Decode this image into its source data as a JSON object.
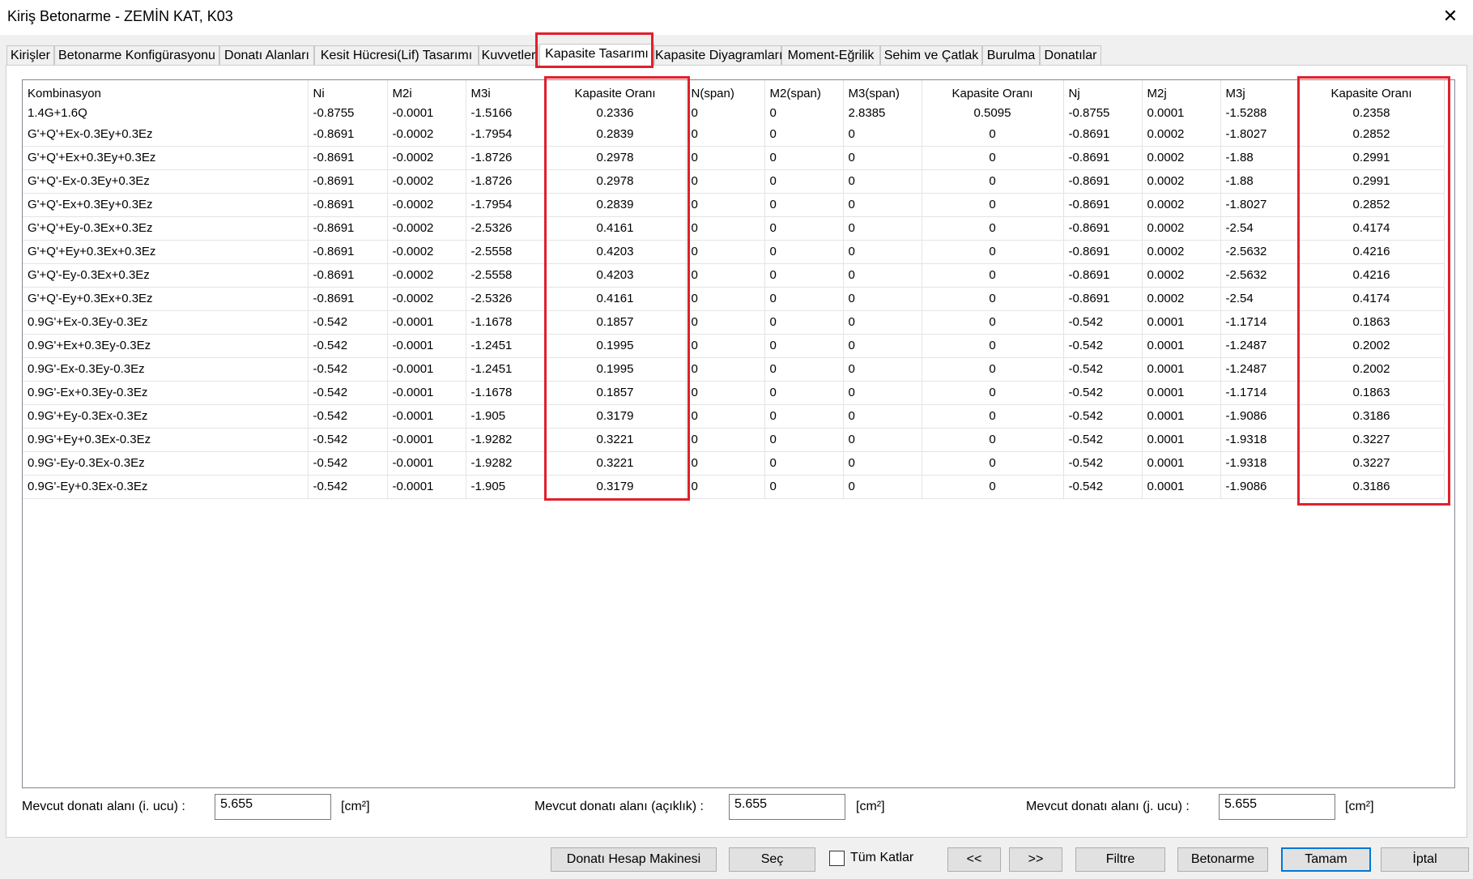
{
  "window": {
    "title": "Kiriş Betonarme - ZEMİN KAT, K03",
    "close_glyph": "✕"
  },
  "tabs": [
    "Kirişler",
    "Betonarme Konfigürasyonu",
    "Donatı Alanları",
    "Kesit Hücresi(Lif) Tasarımı",
    "Kuvvetler",
    "Kapasite Tasarımı",
    "Kapasite Diyagramları",
    "Moment-Eğrilik",
    "Sehim ve Çatlak",
    "Burulma",
    "Donatılar"
  ],
  "active_tab": "Kapasite Tasarımı",
  "table": {
    "columns": [
      "Kombinasyon",
      "Ni",
      "M2i",
      "M3i",
      "Kapasite Oranı",
      "N(span)",
      "M2(span)",
      "M3(span)",
      "Kapasite Oranı",
      "Nj",
      "M2j",
      "M3j",
      "Kapasite Oranı"
    ],
    "rows": [
      [
        "1.4G+1.6Q",
        "-0.8755",
        "-0.0001",
        "-1.5166",
        "0.2336",
        "0",
        "0",
        "2.8385",
        "0.5095",
        "-0.8755",
        "0.0001",
        "-1.5288",
        "0.2358"
      ],
      [
        "G'+Q'+Ex-0.3Ey+0.3Ez",
        "-0.8691",
        "-0.0002",
        "-1.7954",
        "0.2839",
        "0",
        "0",
        "0",
        "0",
        "-0.8691",
        "0.0002",
        "-1.8027",
        "0.2852"
      ],
      [
        "G'+Q'+Ex+0.3Ey+0.3Ez",
        "-0.8691",
        "-0.0002",
        "-1.8726",
        "0.2978",
        "0",
        "0",
        "0",
        "0",
        "-0.8691",
        "0.0002",
        "-1.88",
        "0.2991"
      ],
      [
        "G'+Q'-Ex-0.3Ey+0.3Ez",
        "-0.8691",
        "-0.0002",
        "-1.8726",
        "0.2978",
        "0",
        "0",
        "0",
        "0",
        "-0.8691",
        "0.0002",
        "-1.88",
        "0.2991"
      ],
      [
        "G'+Q'-Ex+0.3Ey+0.3Ez",
        "-0.8691",
        "-0.0002",
        "-1.7954",
        "0.2839",
        "0",
        "0",
        "0",
        "0",
        "-0.8691",
        "0.0002",
        "-1.8027",
        "0.2852"
      ],
      [
        "G'+Q'+Ey-0.3Ex+0.3Ez",
        "-0.8691",
        "-0.0002",
        "-2.5326",
        "0.4161",
        "0",
        "0",
        "0",
        "0",
        "-0.8691",
        "0.0002",
        "-2.54",
        "0.4174"
      ],
      [
        "G'+Q'+Ey+0.3Ex+0.3Ez",
        "-0.8691",
        "-0.0002",
        "-2.5558",
        "0.4203",
        "0",
        "0",
        "0",
        "0",
        "-0.8691",
        "0.0002",
        "-2.5632",
        "0.4216"
      ],
      [
        "G'+Q'-Ey-0.3Ex+0.3Ez",
        "-0.8691",
        "-0.0002",
        "-2.5558",
        "0.4203",
        "0",
        "0",
        "0",
        "0",
        "-0.8691",
        "0.0002",
        "-2.5632",
        "0.4216"
      ],
      [
        "G'+Q'-Ey+0.3Ex+0.3Ez",
        "-0.8691",
        "-0.0002",
        "-2.5326",
        "0.4161",
        "0",
        "0",
        "0",
        "0",
        "-0.8691",
        "0.0002",
        "-2.54",
        "0.4174"
      ],
      [
        "0.9G'+Ex-0.3Ey-0.3Ez",
        "-0.542",
        "-0.0001",
        "-1.1678",
        "0.1857",
        "0",
        "0",
        "0",
        "0",
        "-0.542",
        "0.0001",
        "-1.1714",
        "0.1863"
      ],
      [
        "0.9G'+Ex+0.3Ey-0.3Ez",
        "-0.542",
        "-0.0001",
        "-1.2451",
        "0.1995",
        "0",
        "0",
        "0",
        "0",
        "-0.542",
        "0.0001",
        "-1.2487",
        "0.2002"
      ],
      [
        "0.9G'-Ex-0.3Ey-0.3Ez",
        "-0.542",
        "-0.0001",
        "-1.2451",
        "0.1995",
        "0",
        "0",
        "0",
        "0",
        "-0.542",
        "0.0001",
        "-1.2487",
        "0.2002"
      ],
      [
        "0.9G'-Ex+0.3Ey-0.3Ez",
        "-0.542",
        "-0.0001",
        "-1.1678",
        "0.1857",
        "0",
        "0",
        "0",
        "0",
        "-0.542",
        "0.0001",
        "-1.1714",
        "0.1863"
      ],
      [
        "0.9G'+Ey-0.3Ex-0.3Ez",
        "-0.542",
        "-0.0001",
        "-1.905",
        "0.3179",
        "0",
        "0",
        "0",
        "0",
        "-0.542",
        "0.0001",
        "-1.9086",
        "0.3186"
      ],
      [
        "0.9G'+Ey+0.3Ex-0.3Ez",
        "-0.542",
        "-0.0001",
        "-1.9282",
        "0.3221",
        "0",
        "0",
        "0",
        "0",
        "-0.542",
        "0.0001",
        "-1.9318",
        "0.3227"
      ],
      [
        "0.9G'-Ey-0.3Ex-0.3Ez",
        "-0.542",
        "-0.0001",
        "-1.9282",
        "0.3221",
        "0",
        "0",
        "0",
        "0",
        "-0.542",
        "0.0001",
        "-1.9318",
        "0.3227"
      ],
      [
        "0.9G'-Ey+0.3Ex-0.3Ez",
        "-0.542",
        "-0.0001",
        "-1.905",
        "0.3179",
        "0",
        "0",
        "0",
        "0",
        "-0.542",
        "0.0001",
        "-1.9086",
        "0.3186"
      ]
    ]
  },
  "footer": {
    "i_label": "Mevcut donatı alanı (i. ucu) :",
    "i_value": "5.655",
    "span_label": "Mevcut donatı alanı (açıklık) :",
    "span_value": "5.655",
    "j_label": "Mevcut donatı alanı (j. ucu) :",
    "j_value": "5.655",
    "unit": "[cm²]"
  },
  "buttons": {
    "calc": "Donatı Hesap Makinesi",
    "select": "Seç",
    "all_floors": "Tüm Katlar",
    "prev": "<<",
    "next": ">>",
    "filter": "Filtre",
    "concrete": "Betonarme",
    "ok": "Tamam",
    "cancel": "İptal"
  },
  "colors": {
    "highlight": "#e0202c",
    "default_button_border": "#0078d7"
  }
}
